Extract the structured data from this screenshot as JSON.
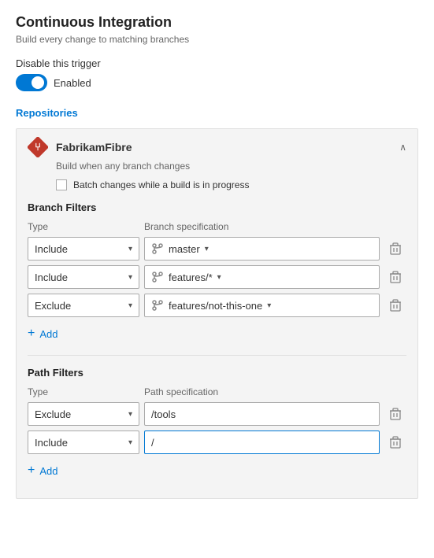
{
  "page": {
    "title": "Continuous Integration",
    "subtitle": "Build every change to matching branches"
  },
  "trigger": {
    "disable_label": "Disable this trigger",
    "enabled_label": "Enabled",
    "is_enabled": true
  },
  "repositories": {
    "section_title": "Repositories",
    "repo": {
      "name": "FabrikamFibre",
      "description": "Build when any branch changes",
      "batch_label": "Batch changes while a build is in progress"
    }
  },
  "branch_filters": {
    "title": "Branch Filters",
    "col_type": "Type",
    "col_spec": "Branch specification",
    "add_label": "Add",
    "rows": [
      {
        "type": "Include",
        "spec": "master"
      },
      {
        "type": "Include",
        "spec": "features/*"
      },
      {
        "type": "Exclude",
        "spec": "features/not-this-one"
      }
    ]
  },
  "path_filters": {
    "title": "Path Filters",
    "col_type": "Type",
    "col_spec": "Path specification",
    "add_label": "Add",
    "rows": [
      {
        "type": "Exclude",
        "spec": "/tools",
        "is_input": false
      },
      {
        "type": "Include",
        "spec": "/",
        "is_input": true
      }
    ]
  },
  "icons": {
    "chevron_down": "▾",
    "chevron_up": "∧",
    "delete": "🗑",
    "add": "+",
    "git_branch": "⑂"
  }
}
